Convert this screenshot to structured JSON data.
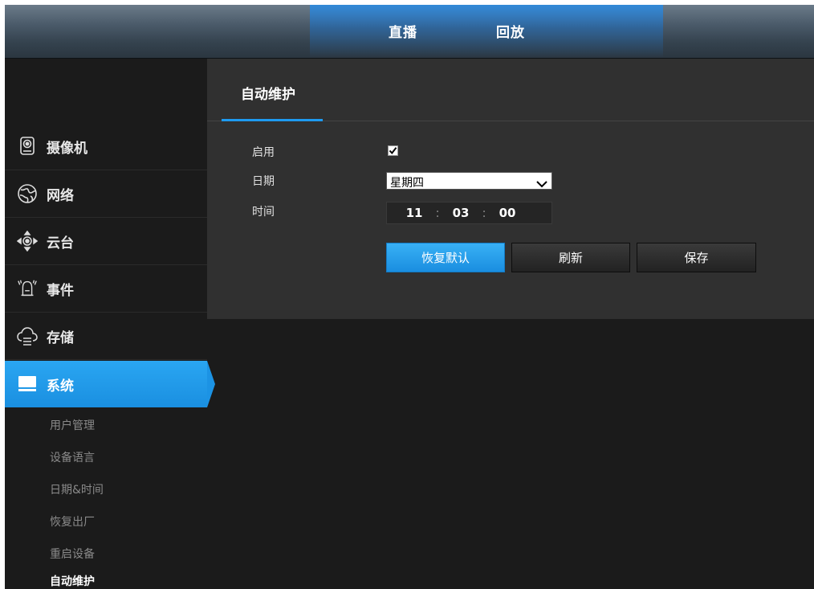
{
  "topnav": {
    "tabs": [
      "直播",
      "回放"
    ]
  },
  "sidebar": {
    "items": [
      {
        "label": "摄像机",
        "icon": "camera-icon"
      },
      {
        "label": "网络",
        "icon": "network-globe-icon"
      },
      {
        "label": "云台",
        "icon": "ptz-icon"
      },
      {
        "label": "事件",
        "icon": "alarm-bell-icon"
      },
      {
        "label": "存储",
        "icon": "cloud-storage-icon"
      },
      {
        "label": "系统",
        "icon": "monitor-icon",
        "active": true
      }
    ],
    "subitems": [
      "用户管理",
      "设备语言",
      "日期&时间",
      "恢复出厂",
      "重启设备",
      "自动维护"
    ],
    "active_subitem": "自动维护"
  },
  "panel": {
    "title": "自动维护",
    "fields": {
      "enable_label": "启用",
      "enabled": true,
      "date_label": "日期",
      "date_value": "星期四",
      "time_label": "时间",
      "hour": "11",
      "minute": "03",
      "second": "00",
      "separator": ":"
    },
    "buttons": {
      "restore_default": "恢复默认",
      "refresh": "刷新",
      "save": "保存"
    }
  },
  "colors": {
    "accent": "#1e9af0",
    "panel_bg": "#303030",
    "page_bg": "#1b1b1b"
  }
}
